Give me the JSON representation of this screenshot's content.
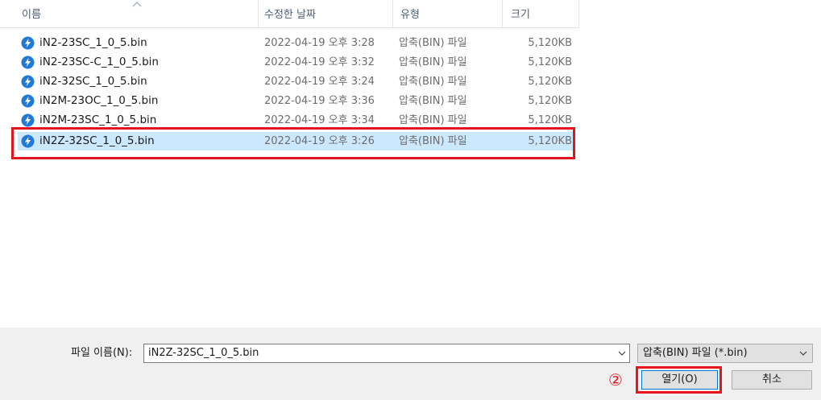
{
  "columns": {
    "name": "이름",
    "date": "수정한 날짜",
    "type": "유형",
    "size": "크기"
  },
  "files": [
    {
      "name": "iN2-23SC_1_0_5.bin",
      "date": "2022-04-19 오후 3:28",
      "type": "압축(BIN) 파일",
      "size": "5,120KB"
    },
    {
      "name": "iN2-23SC-C_1_0_5.bin",
      "date": "2022-04-19 오후 3:32",
      "type": "압축(BIN) 파일",
      "size": "5,120KB"
    },
    {
      "name": "iN2-32SC_1_0_5.bin",
      "date": "2022-04-19 오후 3:24",
      "type": "압축(BIN) 파일",
      "size": "5,120KB"
    },
    {
      "name": "iN2M-23OC_1_0_5.bin",
      "date": "2022-04-19 오후 3:36",
      "type": "압축(BIN) 파일",
      "size": "5,120KB"
    },
    {
      "name": "iN2M-23SC_1_0_5.bin",
      "date": "2022-04-19 오후 3:34",
      "type": "압축(BIN) 파일",
      "size": "5,120KB"
    },
    {
      "name": "iN2Z-32SC_1_0_5.bin",
      "date": "2022-04-19 오후 3:26",
      "type": "압축(BIN) 파일",
      "size": "5,120KB",
      "selected": true
    }
  ],
  "filename": {
    "label": "파일 이름(N):",
    "value": "iN2Z-32SC_1_0_5.bin"
  },
  "filetype": {
    "selected": "압축(BIN) 파일 (*.bin)"
  },
  "buttons": {
    "open": "열기(O)",
    "cancel": "취소"
  },
  "annotation": {
    "step_marker": "②",
    "highlight_color": "#e8141d"
  },
  "colors": {
    "selection": "#cce8ff",
    "icon": "#1f7ad8"
  },
  "icons": {
    "file": "bin-file-icon",
    "sort": "sort-ascending-icon",
    "dropdown": "chevron-down-icon"
  }
}
